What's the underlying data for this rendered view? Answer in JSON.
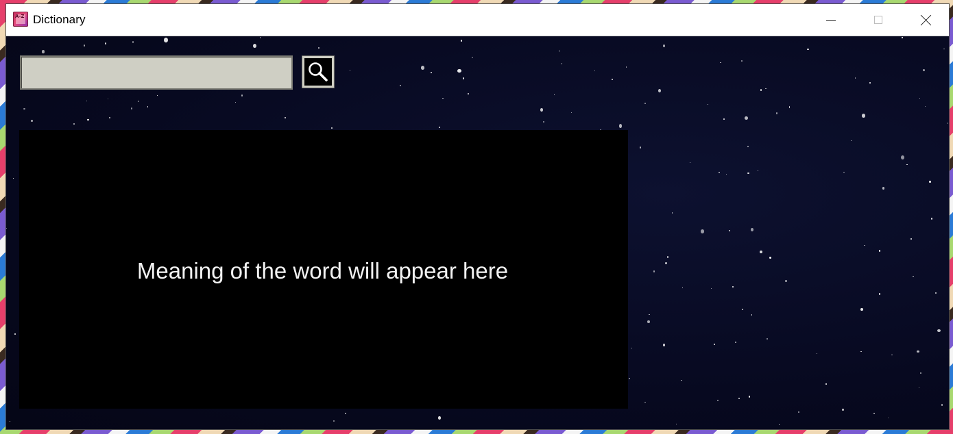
{
  "window": {
    "title": "Dictionary",
    "controls": {
      "minimize": "minimize",
      "maximize": "maximize",
      "close": "close"
    }
  },
  "search": {
    "value": "",
    "placeholder": "",
    "button_icon": "magnifier-icon"
  },
  "meaning": {
    "text": "Meaning of the word will appear here"
  },
  "colors": {
    "background": "#070920",
    "input_bg": "#cfcfc4",
    "panel_bg": "#000000",
    "text": "#f2f2f2"
  }
}
